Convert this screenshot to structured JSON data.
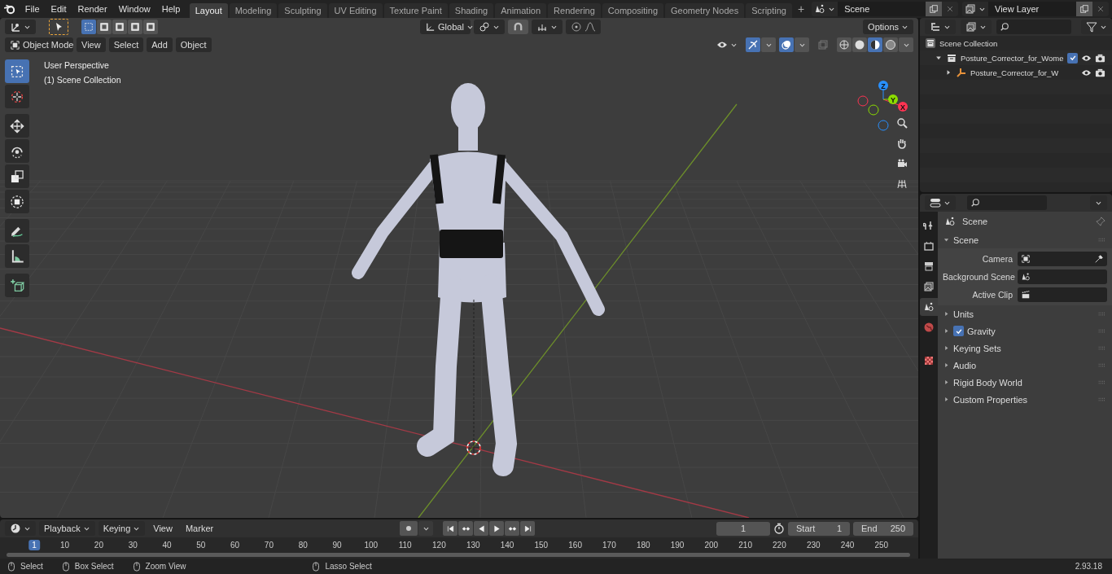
{
  "top_bar": {
    "menu": [
      "File",
      "Edit",
      "Render",
      "Window",
      "Help"
    ],
    "workspaces": [
      {
        "label": "Layout",
        "selected": true
      },
      {
        "label": "Modeling",
        "selected": false
      },
      {
        "label": "Sculpting",
        "selected": false
      },
      {
        "label": "UV Editing",
        "selected": false
      },
      {
        "label": "Texture Paint",
        "selected": false
      },
      {
        "label": "Shading",
        "selected": false
      },
      {
        "label": "Animation",
        "selected": false
      },
      {
        "label": "Rendering",
        "selected": false
      },
      {
        "label": "Compositing",
        "selected": false
      },
      {
        "label": "Geometry Nodes",
        "selected": false
      },
      {
        "label": "Scripting",
        "selected": false
      }
    ],
    "add_workspace": "+",
    "scene": "Scene",
    "view_layer": "View Layer"
  },
  "viewport": {
    "selection_modes": [
      {
        "selected": true
      },
      {
        "selected": false
      },
      {
        "selected": false
      },
      {
        "selected": false
      },
      {
        "selected": false
      }
    ],
    "orientation": "Global",
    "options": "Options",
    "mode": "Object Mode",
    "menus": [
      "View",
      "Select",
      "Add",
      "Object"
    ],
    "shading_modes": [
      {
        "selected": false
      },
      {
        "selected": false
      },
      {
        "selected": true
      },
      {
        "selected": false
      }
    ],
    "overlay_text": [
      "User Perspective",
      "(1) Scene Collection"
    ],
    "tools": [
      {
        "kind": "select",
        "selected": true
      },
      {
        "kind": "cursor",
        "selected": false
      },
      {
        "kind": "move",
        "selected": false
      },
      {
        "kind": "rotate",
        "selected": false
      },
      {
        "kind": "scale",
        "selected": false
      },
      {
        "kind": "transform",
        "selected": false
      },
      {
        "kind": "annotate",
        "selected": false
      },
      {
        "kind": "measure",
        "selected": false
      },
      {
        "kind": "add_cube",
        "selected": false
      }
    ],
    "gizmo_axes": [
      {
        "label": "X",
        "color": "#ff3352"
      },
      {
        "label": "Y",
        "color": "#8bdc00"
      },
      {
        "label": "Z",
        "color": "#2890ff"
      }
    ]
  },
  "timeline": {
    "menus": [
      "Playback",
      "Keying",
      "View",
      "Marker"
    ],
    "current_frame": "1",
    "start_label": "Start",
    "start": "1",
    "end_label": "End",
    "end": "250",
    "ruler": [
      {
        "label": "1",
        "selected": true
      },
      {
        "label": "10",
        "selected": false
      },
      {
        "label": "20",
        "selected": false
      },
      {
        "label": "30",
        "selected": false
      },
      {
        "label": "40",
        "selected": false
      },
      {
        "label": "50",
        "selected": false
      },
      {
        "label": "60",
        "selected": false
      },
      {
        "label": "70",
        "selected": false
      },
      {
        "label": "80",
        "selected": false
      },
      {
        "label": "90",
        "selected": false
      },
      {
        "label": "100",
        "selected": false
      },
      {
        "label": "110",
        "selected": false
      },
      {
        "label": "120",
        "selected": false
      },
      {
        "label": "130",
        "selected": false
      },
      {
        "label": "140",
        "selected": false
      },
      {
        "label": "150",
        "selected": false
      },
      {
        "label": "160",
        "selected": false
      },
      {
        "label": "170",
        "selected": false
      },
      {
        "label": "180",
        "selected": false
      },
      {
        "label": "190",
        "selected": false
      },
      {
        "label": "200",
        "selected": false
      },
      {
        "label": "210",
        "selected": false
      },
      {
        "label": "220",
        "selected": false
      },
      {
        "label": "230",
        "selected": false
      },
      {
        "label": "240",
        "selected": false
      },
      {
        "label": "250",
        "selected": false
      }
    ]
  },
  "outliner": {
    "rows": [
      {
        "label": "Scene Collection",
        "kind": "scene_collection",
        "children": [
          {
            "label": "Posture_Corrector_for_Wome",
            "kind": "collection",
            "expanded": true,
            "checked": true,
            "children": [
              {
                "label": "Posture_Corrector_for_W",
                "kind": "object",
                "expanded": false
              }
            ]
          }
        ]
      }
    ]
  },
  "properties": {
    "tabs": [
      {
        "kind": "tool",
        "selected": false
      },
      {
        "kind": "render",
        "selected": false
      },
      {
        "kind": "output",
        "selected": false
      },
      {
        "kind": "view_layer",
        "selected": false
      },
      {
        "kind": "scene",
        "selected": true
      },
      {
        "kind": "world",
        "selected": false
      },
      {
        "kind": "texture",
        "selected": false
      }
    ],
    "context": "Scene",
    "panels": [
      {
        "label": "Scene",
        "expanded": true,
        "fields": [
          {
            "label": "Camera",
            "kind": "camera"
          },
          {
            "label": "Background Scene",
            "kind": "scene"
          },
          {
            "label": "Active Clip",
            "kind": "clip"
          }
        ]
      },
      {
        "label": "Units",
        "expanded": false
      },
      {
        "label": "Gravity",
        "expanded": false,
        "checked": true
      },
      {
        "label": "Keying Sets",
        "expanded": false
      },
      {
        "label": "Audio",
        "expanded": false
      },
      {
        "label": "Rigid Body World",
        "expanded": false
      },
      {
        "label": "Custom Properties",
        "expanded": false
      }
    ]
  },
  "status_bar": {
    "items": [
      "Select",
      "Box Select",
      "Zoom View",
      "Lasso Select"
    ],
    "version": "2.93.18"
  }
}
